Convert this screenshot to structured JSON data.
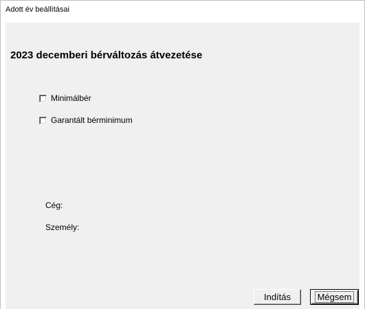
{
  "window": {
    "title": "Adott év beállításai"
  },
  "main": {
    "heading": "2023 decemberi bérváltozás átvezetése",
    "options": [
      {
        "label": "Minimálbér",
        "checked": false
      },
      {
        "label": "Garantált bérminimum",
        "checked": false
      }
    ],
    "info": {
      "company_label": "Cég:",
      "person_label": "Személy:"
    }
  },
  "buttons": {
    "start_label": "Indítás",
    "cancel_label": "Mégsem"
  }
}
